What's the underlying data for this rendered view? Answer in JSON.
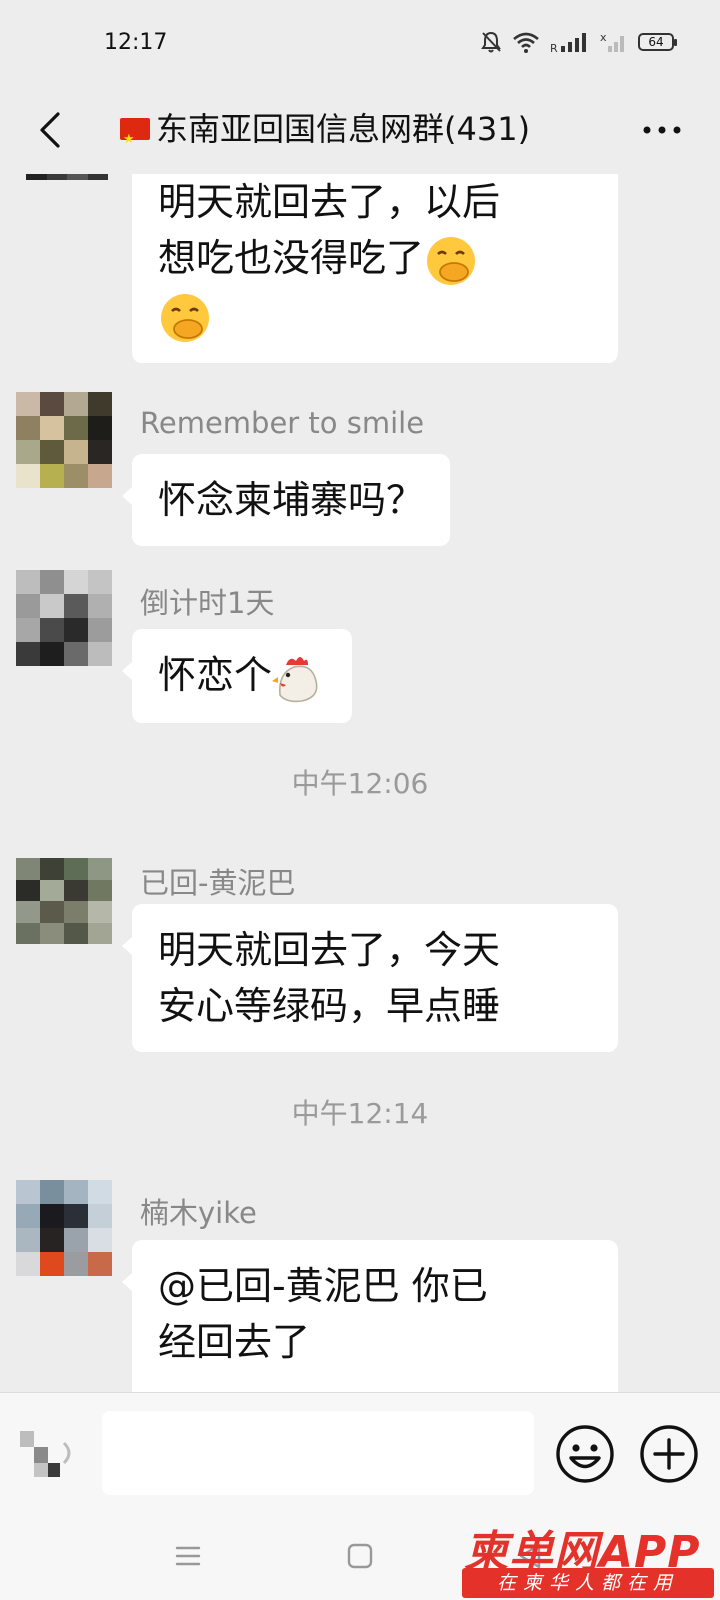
{
  "status_bar": {
    "time": "12:17",
    "battery": "64",
    "icons": [
      "bell-off-icon",
      "wifi-icon",
      "signal-icon",
      "signal-no-service-icon",
      "battery-icon"
    ]
  },
  "header": {
    "title": "东南亚回国信息网群(431)",
    "icons": [
      "back-icon",
      "china-flag-icon",
      "more-icon"
    ]
  },
  "messages": [
    {
      "sender": "",
      "lines": [
        "明天就回去了，以后",
        "想吃也没得吃了"
      ],
      "emojis": [
        "hand-over-mouth-emoji",
        "hand-over-mouth-emoji"
      ]
    },
    {
      "sender": "Remember to smile",
      "lines": [
        "怀念柬埔寨吗？"
      ]
    },
    {
      "sender": "倒计时1天",
      "lines": [
        "怀恋个"
      ],
      "emojis": [
        "chicken-emoji"
      ]
    },
    {
      "timestamp": "中午12:06"
    },
    {
      "sender": "已回-黄泥巴",
      "lines": [
        "明天就回去了，今天",
        "安心等绿码，早点睡"
      ]
    },
    {
      "timestamp": "中午12:14"
    },
    {
      "sender": "楠木yike",
      "lines": [
        "@已回-黄泥巴  你已",
        "经回去了"
      ]
    }
  ],
  "input_bar": {
    "placeholder": "",
    "icons": [
      "voice-icon",
      "emoji-icon",
      "plus-icon"
    ]
  },
  "nav_bar": {
    "icons": [
      "menu-icon",
      "home-icon",
      "back-triangle-icon"
    ]
  },
  "watermark": {
    "brand": "柬单网APP",
    "tagline": "在柬华人都在用"
  },
  "colors": {
    "background": "#ededed",
    "bubble": "#ffffff",
    "sender_text": "#888888",
    "watermark_red": "#e4322b"
  }
}
